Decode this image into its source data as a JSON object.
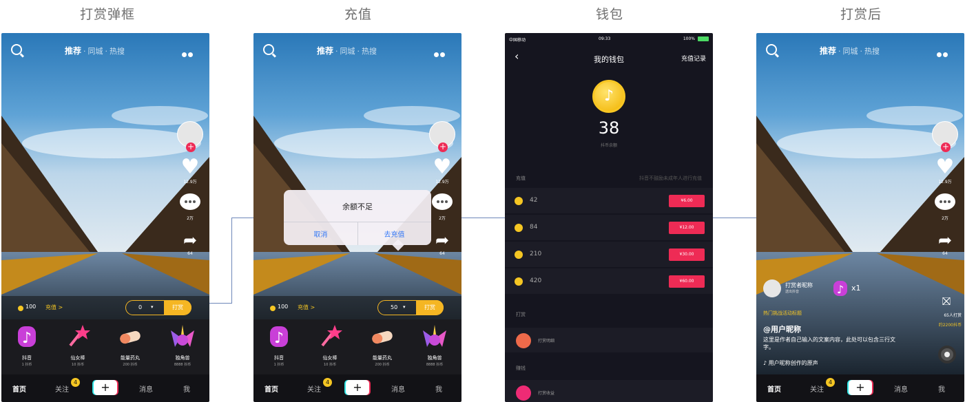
{
  "columns": [
    "打赏弹框",
    "充值",
    "钱包",
    "打赏后"
  ],
  "feed": {
    "tabs": [
      "推荐",
      "同城",
      "热搜"
    ],
    "side_counts": {
      "likes": "12.9万",
      "comments": "2万",
      "shares": "64"
    },
    "gift_label": "打赏"
  },
  "gift_bar": {
    "balance": "100",
    "recharge_link": "充值 >",
    "qty_screen1": "0",
    "qty_screen2": "50",
    "send_label": "打赏"
  },
  "gifts": [
    {
      "name": "抖音",
      "price": "1 抖币",
      "icon": "tiktok-gift-icon"
    },
    {
      "name": "仙女棒",
      "price": "10 抖币",
      "icon": "fairy-wand-icon"
    },
    {
      "name": "能量药丸",
      "price": "200 抖币",
      "icon": "pill-icon"
    },
    {
      "name": "独角兽",
      "price": "8888 抖币",
      "icon": "unicorn-icon"
    }
  ],
  "bottom_nav": {
    "home": "首页",
    "follow": "关注",
    "follow_badge": "4",
    "plus": "+",
    "messages": "消息",
    "me": "我"
  },
  "dialog": {
    "title": "余额不足",
    "cancel": "取消",
    "recharge": "去充值"
  },
  "wallet": {
    "status": {
      "carrier": "中国移动",
      "time": "09:33",
      "battery": "100%"
    },
    "title": "我的钱包",
    "record": "充值记录",
    "balance": "38",
    "balance_label": "抖币余额",
    "recharge_section": "充值",
    "recharge_hint": "抖音不鼓励未成年人进行充值",
    "packages": [
      {
        "coins": "42",
        "price": "¥6.00"
      },
      {
        "coins": "84",
        "price": "¥12.00"
      },
      {
        "coins": "210",
        "price": "¥30.00"
      },
      {
        "coins": "420",
        "price": "¥60.00"
      }
    ],
    "tip_section": "打赏",
    "tip_item": "打赏明细",
    "earnings_section": "赚钱",
    "earnings_item": "打赏收益"
  },
  "after": {
    "streamer_name": "打赏者昵称",
    "streamer_sub": "送出抖音",
    "multiplier": "x1",
    "hot_tag": "热门挑战活动标题",
    "nickname": "@用户昵称",
    "description": "这里是作者自己输入的文案内容，此处可以包含三行文字。",
    "music": "♪ 用户昵称创作的原声",
    "rank_label": "65人打赏",
    "rank_value": "约2200抖币"
  }
}
